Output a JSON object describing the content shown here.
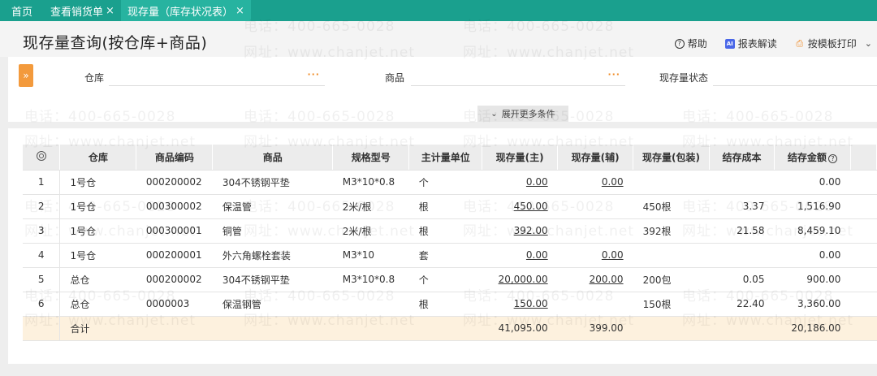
{
  "tabs": [
    {
      "label": "首页",
      "closable": false,
      "active": false
    },
    {
      "label": "查看销货单",
      "closable": true,
      "active": false
    },
    {
      "label": "现存量（库存状况表）",
      "closable": true,
      "active": true
    }
  ],
  "close_glyph": "×",
  "page_title": "现存量查询(按仓库+商品)",
  "actions": {
    "help_label": "帮助",
    "report_label": "报表解读",
    "print_label": "按模板打印",
    "ai_badge": "AI"
  },
  "filters": {
    "warehouse_label": "仓库",
    "goods_label": "商品",
    "status_label": "现存量状态",
    "dots": "···",
    "more_label": "展开更多条件"
  },
  "table": {
    "columns": [
      "仓库",
      "商品编码",
      "商品",
      "规格型号",
      "主计量单位",
      "现存量(主)",
      "现存量(辅)",
      "现存量(包装)",
      "结存成本",
      "结存金额"
    ],
    "rows": [
      {
        "no": "1",
        "warehouse": "1号仓",
        "code": "000200002",
        "name": "304不锈钢平垫",
        "spec": "M3*10*0.8",
        "unit": "个",
        "qty_main": "0.00",
        "qty_aux": "0.00",
        "qty_pack": "",
        "cost": "",
        "amount": "0.00"
      },
      {
        "no": "2",
        "warehouse": "1号仓",
        "code": "000300002",
        "name": "保温管",
        "spec": "2米/根",
        "unit": "根",
        "qty_main": "450.00",
        "qty_aux": "",
        "qty_pack": "450根",
        "cost": "3.37",
        "amount": "1,516.90"
      },
      {
        "no": "3",
        "warehouse": "1号仓",
        "code": "000300001",
        "name": "铜管",
        "spec": "2米/根",
        "unit": "根",
        "qty_main": "392.00",
        "qty_aux": "",
        "qty_pack": "392根",
        "cost": "21.58",
        "amount": "8,459.10"
      },
      {
        "no": "4",
        "warehouse": "1号仓",
        "code": "000200001",
        "name": "外六角螺栓套装",
        "spec": "M3*10",
        "unit": "套",
        "qty_main": "0.00",
        "qty_aux": "0.00",
        "qty_pack": "",
        "cost": "",
        "amount": "0.00"
      },
      {
        "no": "5",
        "warehouse": "总仓",
        "code": "000200002",
        "name": "304不锈钢平垫",
        "spec": "M3*10*0.8",
        "unit": "个",
        "qty_main": "20,000.00",
        "qty_aux": "200.00",
        "qty_pack": "200包",
        "cost": "0.05",
        "amount": "900.00"
      },
      {
        "no": "6",
        "warehouse": "总仓",
        "code": "0000003",
        "name": "保温钢管",
        "spec": "",
        "unit": "根",
        "qty_main": "150.00",
        "qty_aux": "",
        "qty_pack": "150根",
        "cost": "22.40",
        "amount": "3,360.00"
      }
    ],
    "total": {
      "label": "合计",
      "qty_main": "41,095.00",
      "qty_aux": "399.00",
      "amount": "20,186.00"
    }
  },
  "watermark": {
    "phone": "电话：400-665-0028",
    "site": "网址：www.chanjet.net"
  },
  "colors": {
    "tabbar": "#1aa08e",
    "tab_active": "#27b3a0",
    "accent_orange": "#f39a3c",
    "total_row": "#fdf1de"
  }
}
